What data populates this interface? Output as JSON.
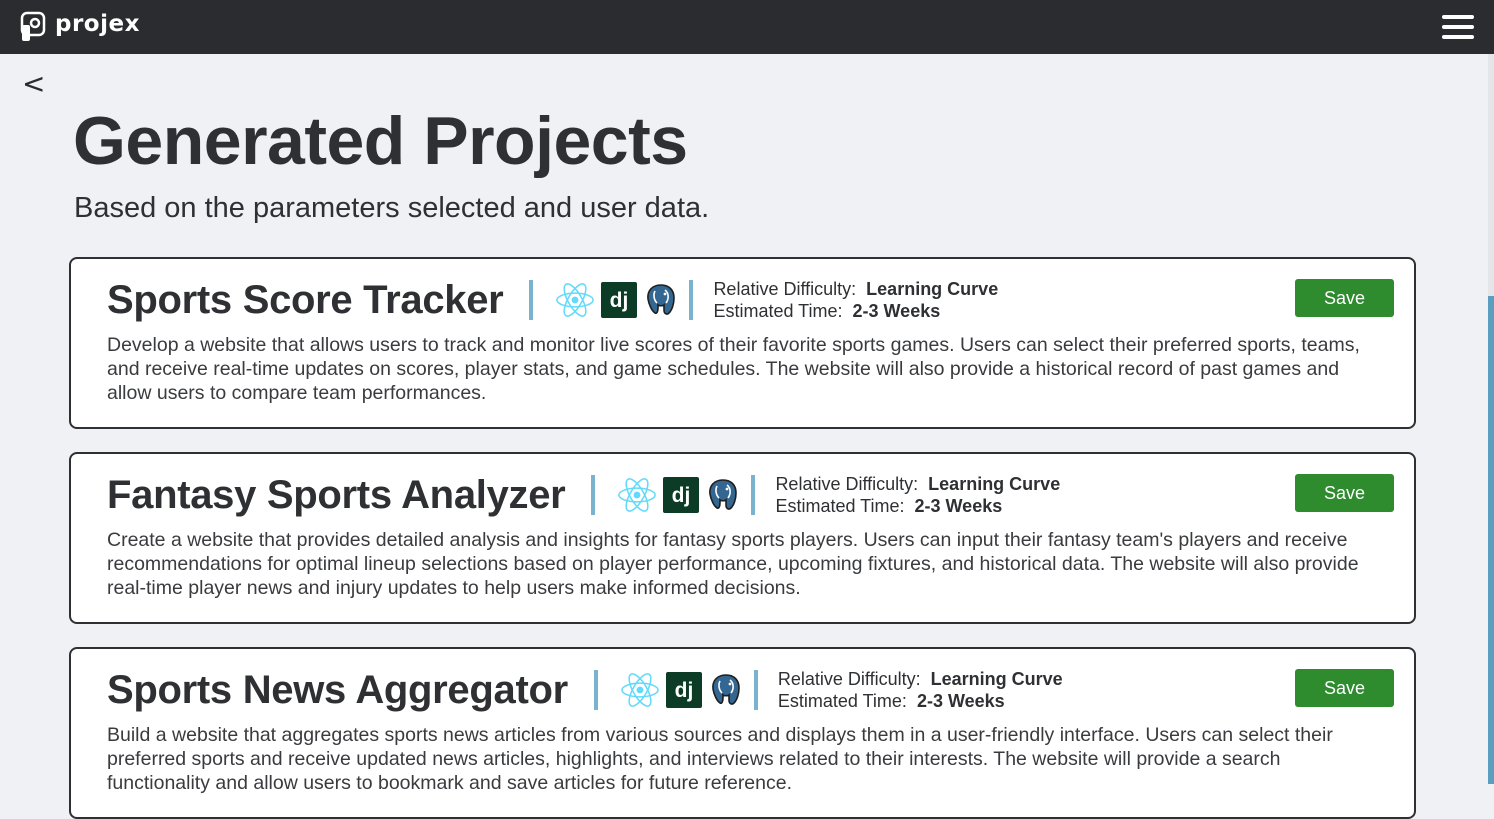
{
  "app": {
    "name": "projex"
  },
  "nav": {
    "back_label": "<"
  },
  "header": {
    "title": "Generated Projects",
    "subtitle": "Based on the parameters selected and user data."
  },
  "labels": {
    "difficulty": "Relative Difficulty:",
    "time": "Estimated Time:",
    "save": "Save",
    "django_logo_text": "dj"
  },
  "colors": {
    "topbar": "#2b2c2f",
    "save_button": "#2e8b2e",
    "accent_divider": "#7ab3cd",
    "react": "#61dafb",
    "django": "#0c3c26",
    "postgres": "#336791"
  },
  "projects": [
    {
      "title": "Sports Score Tracker",
      "tech_icons": [
        "react-icon",
        "django-icon",
        "postgresql-icon"
      ],
      "difficulty": "Learning Curve",
      "time": "2-3 Weeks",
      "description": "Develop a website that allows users to track and monitor live scores of their favorite sports games. Users can select their preferred sports, teams, and receive real-time updates on scores, player stats, and game schedules. The website will also provide a historical record of past games and allow users to compare team performances."
    },
    {
      "title": "Fantasy Sports Analyzer",
      "tech_icons": [
        "react-icon",
        "django-icon",
        "postgresql-icon"
      ],
      "difficulty": "Learning Curve",
      "time": "2-3 Weeks",
      "description": "Create a website that provides detailed analysis and insights for fantasy sports players. Users can input their fantasy team's players and receive recommendations for optimal lineup selections based on player performance, upcoming fixtures, and historical data. The website will also provide real-time player news and injury updates to help users make informed decisions."
    },
    {
      "title": "Sports News Aggregator",
      "tech_icons": [
        "react-icon",
        "django-icon",
        "postgresql-icon"
      ],
      "difficulty": "Learning Curve",
      "time": "2-3 Weeks",
      "description": "Build a website that aggregates sports news articles from various sources and displays them in a user-friendly interface. Users can select their preferred sports and receive updated news articles, highlights, and interviews related to their interests. The website will provide a search functionality and allow users to bookmark and save articles for future reference."
    }
  ]
}
